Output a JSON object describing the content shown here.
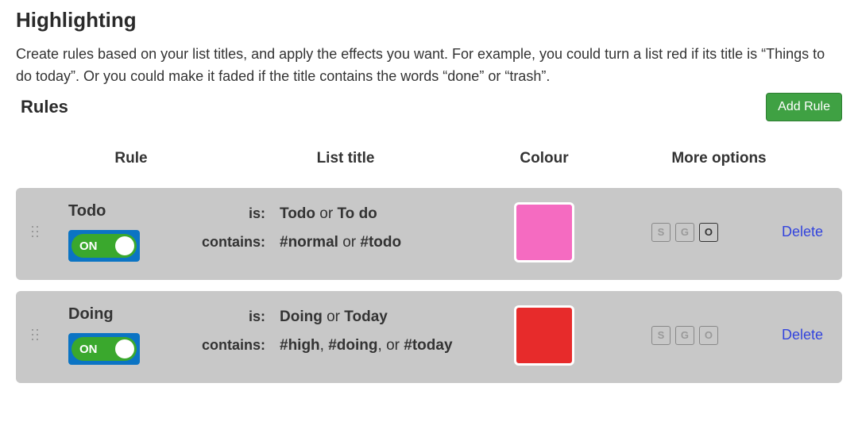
{
  "page": {
    "heading": "Highlighting",
    "description": "Create rules based on your list titles, and apply the effects you want. For example, you could turn a list red if its title is “Things to do today”. Or you could make it faded if the title contains the words “done” or “trash”.",
    "rules_title": "Rules",
    "add_rule_label": "Add Rule"
  },
  "columns": {
    "rule": "Rule",
    "list_title": "List title",
    "colour": "Colour",
    "more_options": "More options"
  },
  "labels": {
    "is": "is:",
    "contains": "contains:",
    "on": "ON",
    "delete": "Delete",
    "s": "S",
    "g": "G",
    "o": "O"
  },
  "rules": [
    {
      "name": "Todo",
      "enabled": true,
      "is_html": "<b>Todo</b> <span class='or'>or</span> <b>To do</b>",
      "contains_html": "<b>#normal</b> <span class='or'>or</span> <b>#todo</b>",
      "colour": "#f56bc1",
      "sgo": {
        "s": false,
        "g": false,
        "o": true
      }
    },
    {
      "name": "Doing",
      "enabled": true,
      "is_html": "<b>Doing</b> <span class='or'>or</span> <b>Today</b>",
      "contains_html": "<b>#high</b>, <b>#doing</b>, <span class='or'>or</span> <b>#today</b>",
      "colour": "#e72b2b",
      "sgo": {
        "s": false,
        "g": false,
        "o": false
      }
    }
  ]
}
